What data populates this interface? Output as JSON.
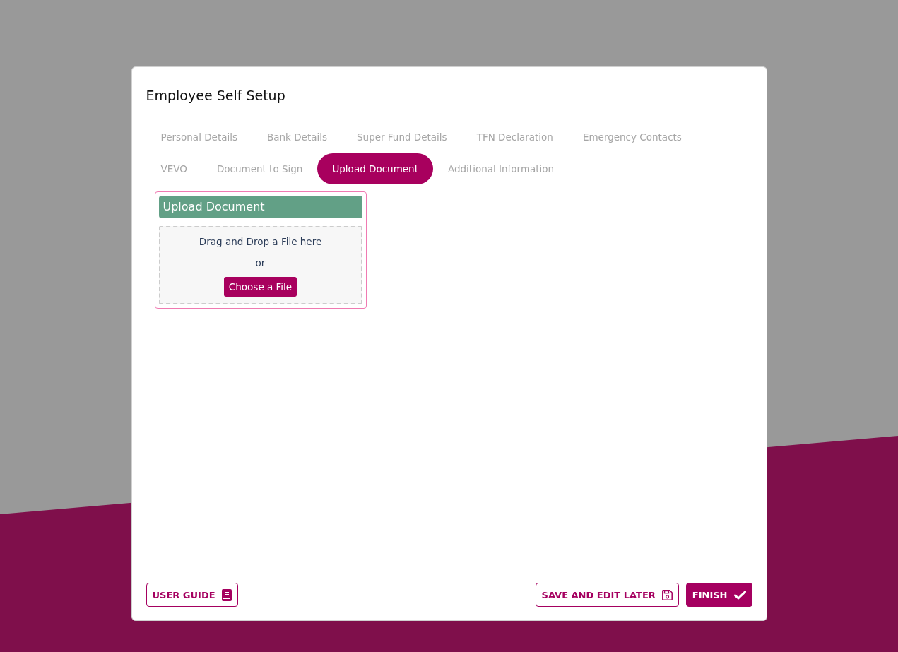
{
  "dialog": {
    "title": "Employee Self Setup"
  },
  "tabs": [
    {
      "label": "Personal Details",
      "selected": false
    },
    {
      "label": "Bank Details",
      "selected": false
    },
    {
      "label": "Super Fund Details",
      "selected": false
    },
    {
      "label": "TFN Declaration",
      "selected": false
    },
    {
      "label": "Emergency Contacts",
      "selected": false
    },
    {
      "label": "VEVO",
      "selected": false
    },
    {
      "label": "Document to Sign",
      "selected": false
    },
    {
      "label": "Upload Document",
      "selected": true
    },
    {
      "label": "Additional Information",
      "selected": false
    }
  ],
  "upload_panel": {
    "title": "Upload Document",
    "drop_text": "Drag and Drop a File here",
    "or_text": "or",
    "button": "Choose a File"
  },
  "footer": {
    "left_buttons": [
      {
        "label": "USER GUIDE",
        "kind": "guide"
      }
    ],
    "right_buttons": [
      {
        "label": "SAVE AND EDIT LATER",
        "kind": "save"
      },
      {
        "label": "FINISH",
        "kind": "finish"
      }
    ]
  }
}
